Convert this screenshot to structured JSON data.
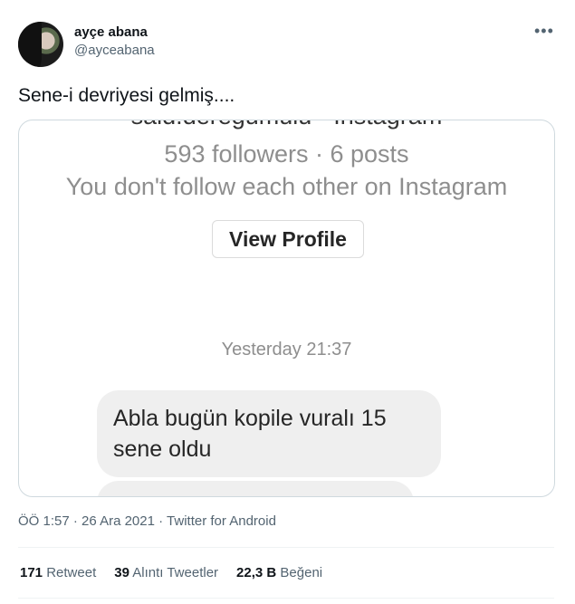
{
  "author": {
    "display_name": "ayçe abana",
    "handle": "@ayceabana"
  },
  "more_icon": "more-horizontal-icon",
  "tweet": {
    "text": "Sene-i devriyesi gelmiş...."
  },
  "screenshot": {
    "clipped_title": "said.deregumulu · Instagram",
    "stats": "593 followers · 6 posts",
    "mutual": "You don't follow each other on Instagram",
    "view_profile_label": "View Profile",
    "timestamp": "Yesterday 21:37",
    "message": "Abla bugün kopile vuralı 15 sene oldu"
  },
  "meta": {
    "time": "ÖÖ 1:57",
    "separator": "·",
    "date": "26 Ara 2021",
    "source": "Twitter for Android"
  },
  "engagement": {
    "retweets_count": "171",
    "retweets_label": "Retweet",
    "quotes_count": "39",
    "quotes_label": "Alıntı Tweetler",
    "likes_count": "22,3 B",
    "likes_label": "Beğeni"
  },
  "colors": {
    "text_primary": "#0f1419",
    "text_secondary": "#536471",
    "border": "#cfd9de",
    "bubble": "#efefef"
  }
}
